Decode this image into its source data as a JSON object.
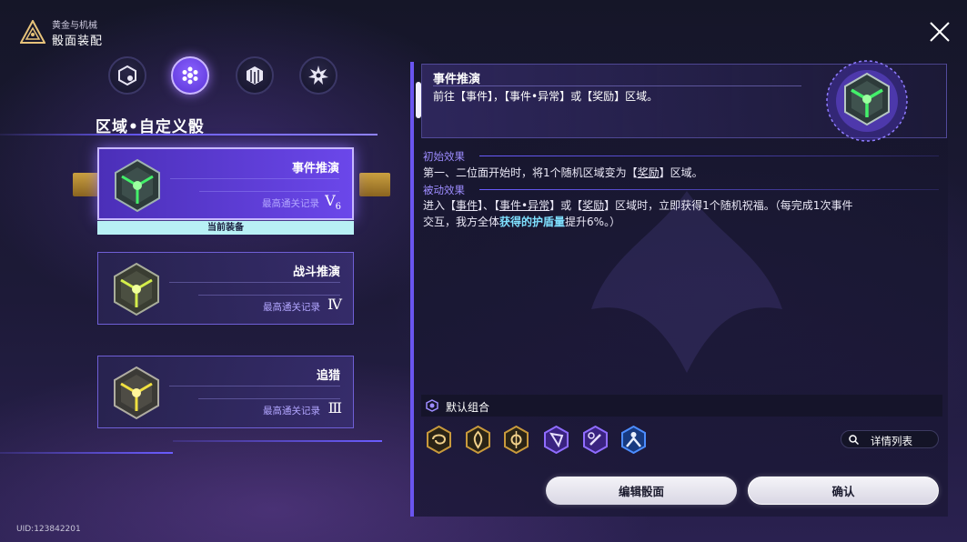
{
  "header": {
    "subtitle": "黄金与机械",
    "title": "骰面装配"
  },
  "tabs": [
    {
      "icon": "tab-dice-c-icon",
      "active": false
    },
    {
      "icon": "tab-dots-icon",
      "active": true
    },
    {
      "icon": "tab-cube-icon",
      "active": false
    },
    {
      "icon": "tab-gear-icon",
      "active": false
    }
  ],
  "section_title": "区域•自定义骰",
  "cards": [
    {
      "name": "事件推演",
      "record_label": "最高通关记录",
      "rank": "V",
      "rank_sub": "6",
      "equipped": true,
      "core_color": "#43f06a"
    },
    {
      "name": "战斗推演",
      "record_label": "最高通关记录",
      "rank": "Ⅳ",
      "rank_sub": "",
      "equipped": false,
      "core_color": "#d4ee4a"
    },
    {
      "name": "追猎",
      "record_label": "最高通关记录",
      "rank": "Ⅲ",
      "rank_sub": "",
      "equipped": false,
      "core_color": "#f0e040"
    }
  ],
  "equipped_label": "当前装备",
  "detail": {
    "name": "事件推演",
    "description": "前往【事件】，【事件•异常】或【奖励】区域。",
    "initial_effect_label": "初始效果",
    "initial_effect": {
      "pre": "第一、二位面开始时，将1个随机区域变为【",
      "ul": "奖励",
      "post": "】区域。"
    },
    "passive_effect_label": "被动效果",
    "passive_effect": {
      "p1": "进入【",
      "u1": "事件",
      "p2": "】、【",
      "u2": "事件•异常",
      "p3": "】或【",
      "u3": "奖励",
      "p4": "】区域时，立即获得1个随机祝福。（每完成1次事件",
      "line2_pre": "交互，我方全体",
      "line2_hl": "获得的护盾量",
      "line2_post": "提升6%。）"
    }
  },
  "default_combo": {
    "label": "默认组合",
    "faces": [
      {
        "icon": "face-swirl-icon",
        "color": "#c99a3c"
      },
      {
        "icon": "face-flame-icon",
        "color": "#c99a3c"
      },
      {
        "icon": "face-cross-icon",
        "color": "#c99a3c"
      },
      {
        "icon": "face-flag-icon",
        "color": "#6e45d8"
      },
      {
        "icon": "face-sword-icon",
        "color": "#6e45d8"
      },
      {
        "icon": "face-person-icon",
        "color": "#2f6fe0"
      }
    ],
    "detail_list_label": "详情列表"
  },
  "buttons": {
    "edit": "编辑骰面",
    "confirm": "确认"
  },
  "uid": "UID:123842201",
  "colors": {
    "accent": "#6a5cff",
    "active_card": "#5a3ad8",
    "equipped_bar": "#b8f0f5"
  }
}
